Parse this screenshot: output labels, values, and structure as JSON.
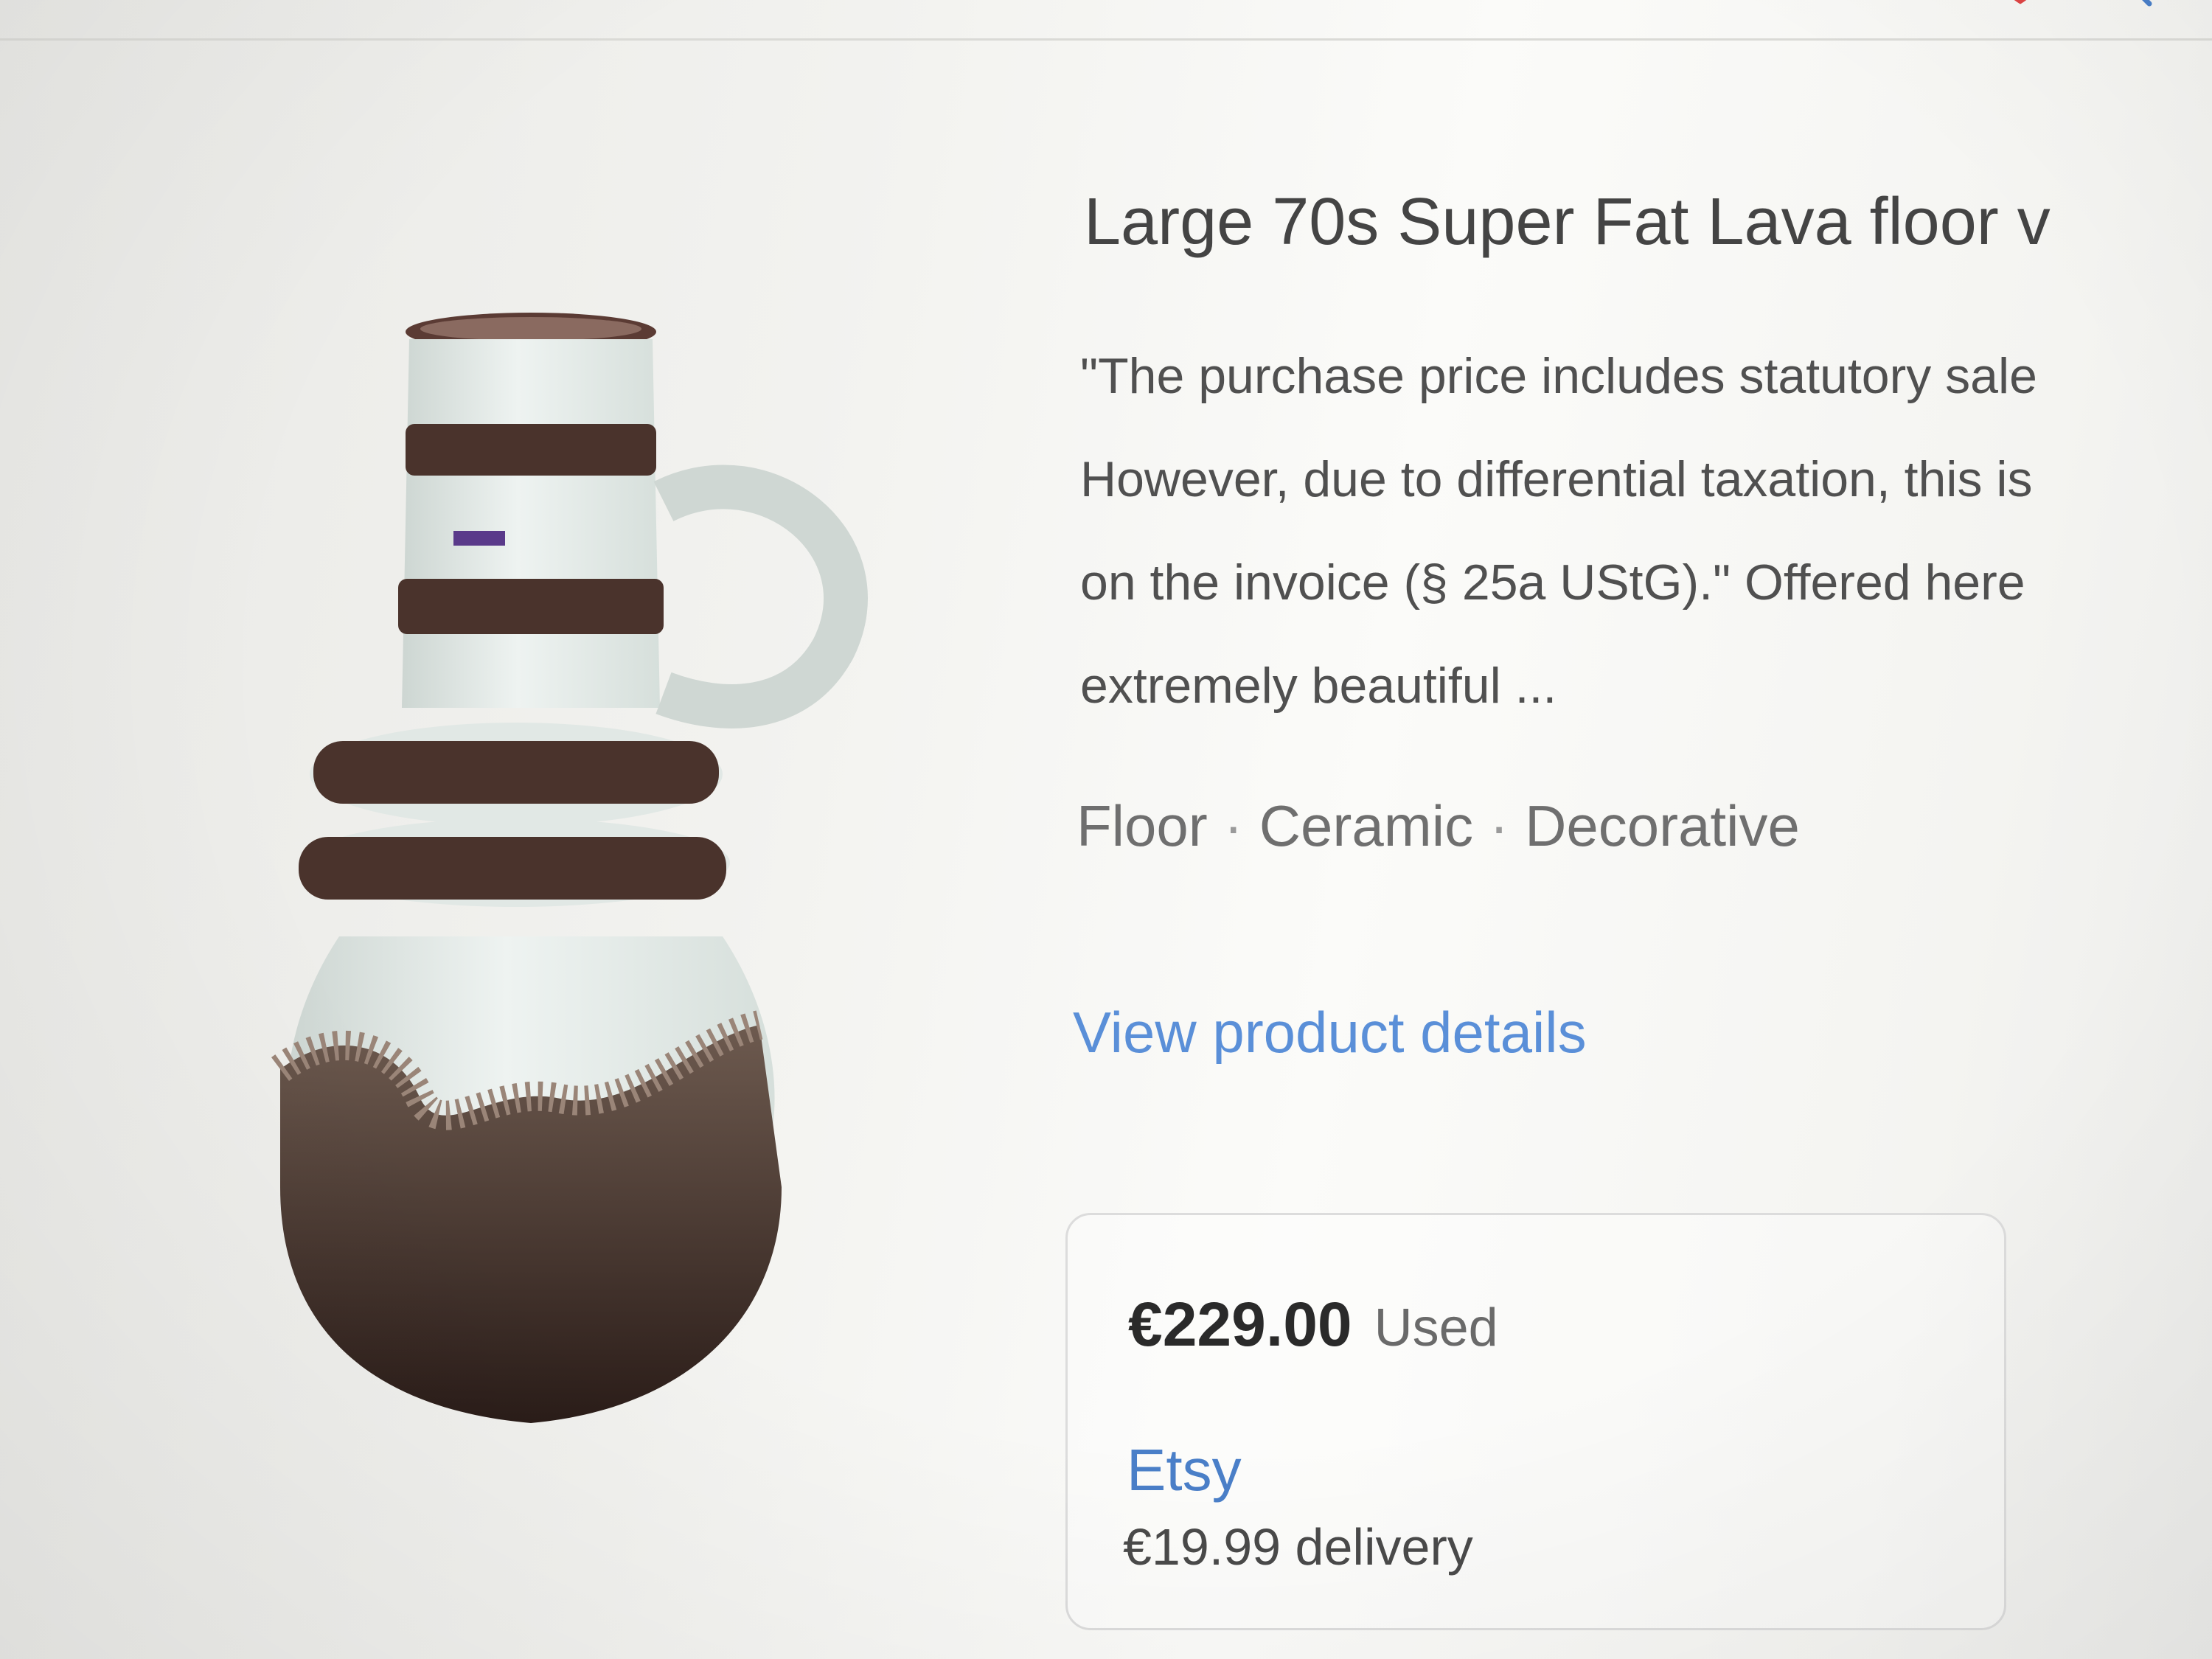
{
  "product": {
    "title": "Large 70s Super Fat Lava floor v",
    "description_lines": [
      "\"The purchase price includes statutory sale",
      "However, due to differential taxation, this is",
      "on the invoice (§ 25a UStG).\" Offered here",
      "extremely beautiful ..."
    ],
    "tags": [
      "Floor",
      "Ceramic",
      "Decorative"
    ],
    "tag_separator": "·",
    "details_link": "View product details"
  },
  "offer": {
    "price": "€229.00",
    "condition": "Used",
    "seller": "Etsy",
    "delivery": "€19.99 delivery"
  },
  "icons": {
    "product_image": "fat-lava-vase-image",
    "topbar": [
      "map-pin-icon",
      "search-icon"
    ]
  },
  "colors": {
    "link": "#5a8fd8",
    "seller_link": "#4a7fc8",
    "vase_glaze_white": "#e6eeea",
    "vase_lava_brown": "#3c2620"
  }
}
